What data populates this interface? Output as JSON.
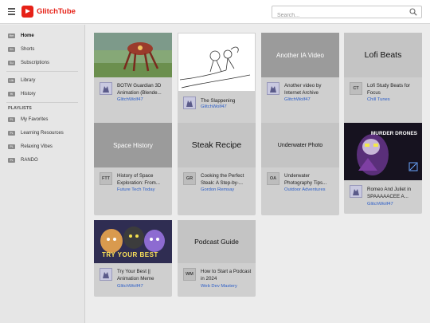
{
  "app": {
    "name": "GlitchTube",
    "brand_color": "#e62117",
    "link_color": "#2c5ec8"
  },
  "search": {
    "placeholder": "Search..."
  },
  "sidebar": {
    "items": [
      {
        "label": "Home",
        "icon": "home-icon",
        "badge": "Hm"
      },
      {
        "label": "Shorts",
        "icon": "shorts-icon",
        "badge": "Sh"
      },
      {
        "label": "Subscriptions",
        "icon": "subscriptions-icon",
        "badge": "Su"
      },
      {
        "label": "Library",
        "icon": "library-icon",
        "badge": "Lib"
      },
      {
        "label": "History",
        "icon": "history-icon",
        "badge": "Hi"
      }
    ],
    "playlists_heading": "PLAYLISTS",
    "playlists": [
      {
        "label": "My Favorites",
        "icon": "playlist-icon",
        "badge": "PL"
      },
      {
        "label": "Learning Resources",
        "icon": "playlist-icon",
        "badge": "PL"
      },
      {
        "label": "Relaxing Vibes",
        "icon": "playlist-icon",
        "badge": "PL"
      },
      {
        "label": "RANDO",
        "icon": "playlist-icon",
        "badge": "PL"
      }
    ]
  },
  "videos": [
    {
      "title": "BOTW Guardian 3D Animation (Blende...",
      "channel": "GlitchWolf47",
      "thumb_text": "",
      "avatar_text": ""
    },
    {
      "title": "The Slappening",
      "channel": "GlitchWolf47",
      "thumb_text": "",
      "avatar_text": ""
    },
    {
      "title": "Another video by Internet Archive",
      "channel": "GlitchWolf47",
      "thumb_text": "Another IA Video",
      "avatar_text": ""
    },
    {
      "title": "Lofi Study Beats for Focus",
      "channel": "Chill Tunes",
      "thumb_text": "Lofi Beats",
      "avatar_text": "CT"
    },
    {
      "title": "History of Space Exploration: From...",
      "channel": "Future Tech Today",
      "thumb_text": "Space History",
      "avatar_text": "FTT"
    },
    {
      "title": "Cooking the Perfect Steak: A Step-by-...",
      "channel": "Gordon Remsay",
      "thumb_text": "Steak Recipe",
      "avatar_text": "GR"
    },
    {
      "title": "Underwater Photography Tips...",
      "channel": "Outdoor Adventures",
      "thumb_text": "Underwater Photo",
      "avatar_text": "OA"
    },
    {
      "title": "Romeo And Juliet in SPAAAAACEE A...",
      "channel": "GlitchWolf47",
      "thumb_text": "MURDER DRONES",
      "avatar_text": ""
    },
    {
      "title": "Try Your Best || Animation Meme",
      "channel": "GlitchWolf47",
      "thumb_text": "TRY YOUR BEST",
      "avatar_text": ""
    },
    {
      "title": "How to Start a Podcast in 2024",
      "channel": "Web Dev Mastery",
      "thumb_text": "Podcast Guide",
      "avatar_text": "WM"
    }
  ]
}
